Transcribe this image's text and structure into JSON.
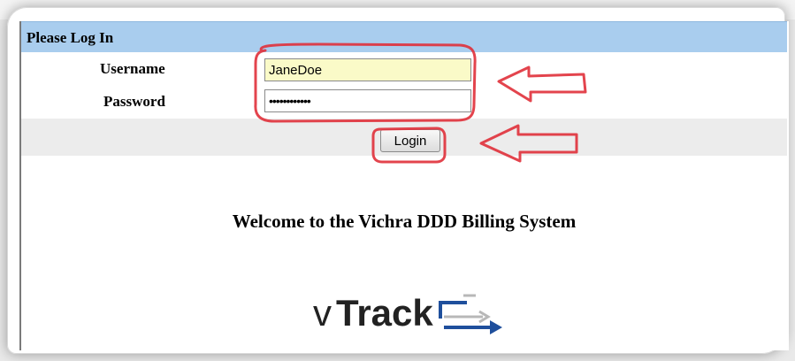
{
  "panel": {
    "title": "Please Log In"
  },
  "form": {
    "username_label": "Username",
    "password_label": "Password",
    "username_value": "JaneDoe",
    "password_value": "••••••••••••",
    "login_label": "Login"
  },
  "welcome_text": "Welcome to the Vichra DDD Billing System",
  "logo": {
    "prefix": "v",
    "word": "Track"
  },
  "colors": {
    "header_bg": "#a9cdee",
    "username_bg": "#fafac8",
    "annotation": "#e0303a",
    "logo_accent": "#1f4f9c"
  },
  "icons": {
    "logo_mark": "arrow-track-icon",
    "annotation_arrow": "left-arrow-icon"
  }
}
